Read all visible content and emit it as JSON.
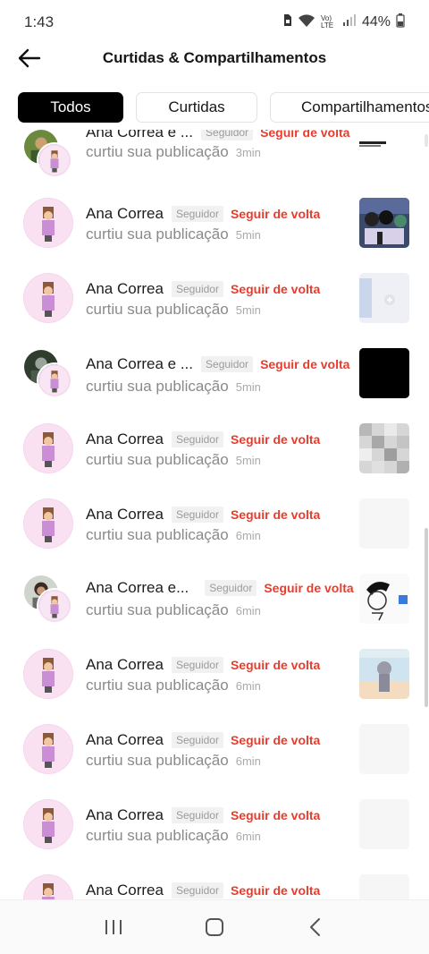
{
  "status_bar": {
    "time": "1:43",
    "network_label": "Vo) LTE",
    "battery": "44%",
    "icons": [
      "sim-icon",
      "wifi-icon",
      "signal-icon",
      "battery-icon"
    ]
  },
  "header": {
    "title": "Curtidas & Compartilhamentos",
    "back_icon": "arrow-left-icon"
  },
  "tabs": [
    {
      "label": "Todos",
      "active": true
    },
    {
      "label": "Curtidas",
      "active": false
    },
    {
      "label": "Compartilhamentos",
      "active": false
    }
  ],
  "notifications": [
    {
      "name": "Ana Correa e ...",
      "badge": "Seguidor",
      "follow_label": "Seguir de volta",
      "action": "curtiu sua publicação",
      "time": "3min",
      "group": true,
      "thumb": "striped"
    },
    {
      "name": "Ana Correa",
      "badge": "Seguidor",
      "follow_label": "Seguir de volta",
      "action": "curtiu sua publicação",
      "time": "5min",
      "group": false,
      "thumb": "anime-group"
    },
    {
      "name": "Ana Correa",
      "badge": "Seguidor",
      "follow_label": "Seguir de volta",
      "action": "curtiu sua publicação",
      "time": "5min",
      "group": false,
      "thumb": "pale-plus"
    },
    {
      "name": "Ana Correa e ...",
      "badge": "Seguidor",
      "follow_label": "Seguir de volta",
      "action": "curtiu sua publicação",
      "time": "5min",
      "group": true,
      "thumb": "black"
    },
    {
      "name": "Ana Correa",
      "badge": "Seguidor",
      "follow_label": "Seguir de volta",
      "action": "curtiu sua publicação",
      "time": "5min",
      "group": false,
      "thumb": "pixel-gray"
    },
    {
      "name": "Ana Correa",
      "badge": "Seguidor",
      "follow_label": "Seguir de volta",
      "action": "curtiu sua publicação",
      "time": "6min",
      "group": false,
      "thumb": "blank"
    },
    {
      "name": "Ana Correa e...",
      "badge": "Seguidor",
      "follow_label": "Seguir de volta",
      "action": "curtiu sua publicação",
      "time": "6min",
      "group": true,
      "thumb": "sketch"
    },
    {
      "name": "Ana Correa",
      "badge": "Seguidor",
      "follow_label": "Seguir de volta",
      "action": "curtiu sua publicação",
      "time": "6min",
      "group": false,
      "thumb": "beach"
    },
    {
      "name": "Ana Correa",
      "badge": "Seguidor",
      "follow_label": "Seguir de volta",
      "action": "curtiu sua publicação",
      "time": "6min",
      "group": false,
      "thumb": "blank"
    },
    {
      "name": "Ana Correa",
      "badge": "Seguidor",
      "follow_label": "Seguir de volta",
      "action": "curtiu sua publicação",
      "time": "6min",
      "group": false,
      "thumb": "blank"
    },
    {
      "name": "Ana Correa",
      "badge": "Seguidor",
      "follow_label": "Seguir de volta",
      "action": "",
      "time": "",
      "group": false,
      "thumb": "blank"
    }
  ],
  "nav_bar": {
    "icons": [
      "recent-apps-icon",
      "home-icon",
      "back-nav-icon"
    ]
  },
  "colors": {
    "accent_red": "#ea3c2c",
    "active_tab": "#000000",
    "badge_bg": "#f1f1f1"
  }
}
